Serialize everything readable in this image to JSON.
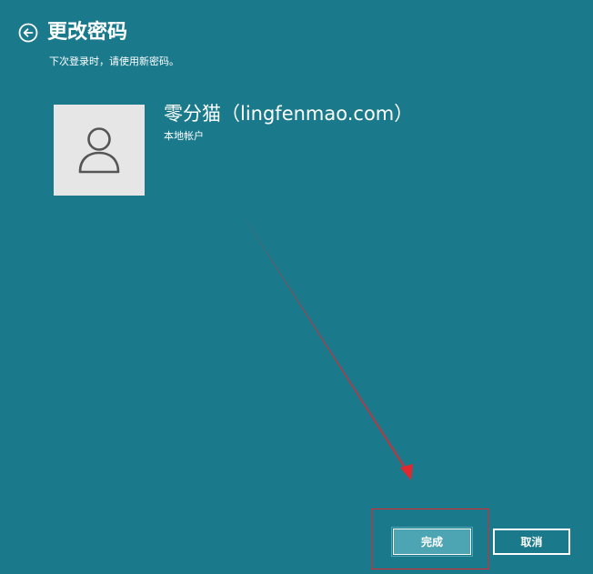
{
  "header": {
    "title": "更改密码",
    "back_icon": "back-arrow-icon"
  },
  "subtitle": "下次登录时，请使用新密码。",
  "account": {
    "name": "零分猫（lingfenmao.com）",
    "type": "本地帐户",
    "avatar_icon": "user-icon"
  },
  "buttons": {
    "finish_label": "完成",
    "cancel_label": "取消"
  },
  "colors": {
    "background": "#1a7a8c",
    "avatar_bg": "#e6e6e6",
    "finish_button_bg": "#4da5b3",
    "annotation_red": "#e0282e"
  }
}
